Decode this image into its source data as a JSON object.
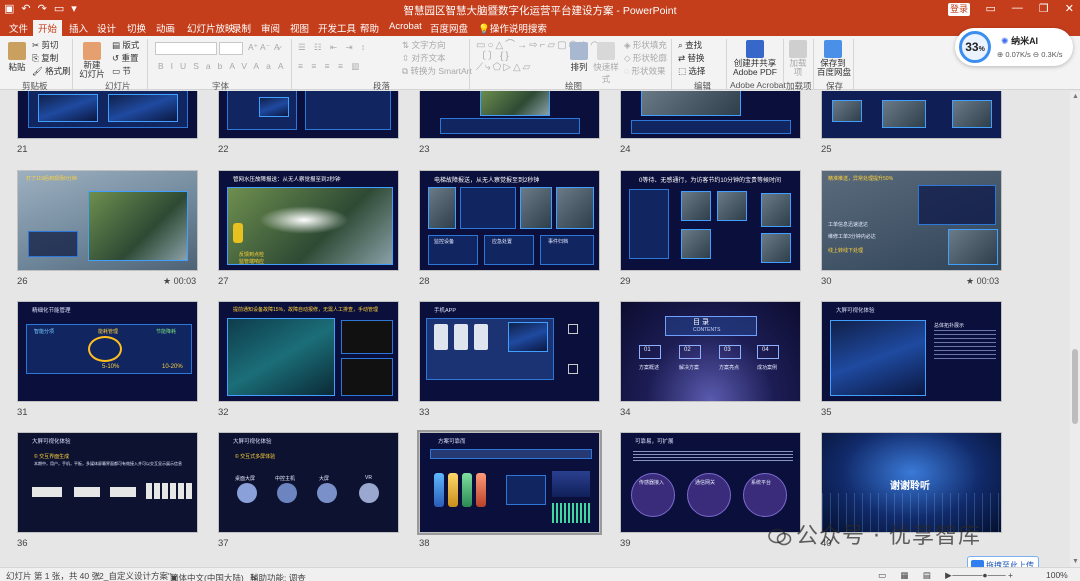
{
  "window": {
    "title": "智慧园区智慧大脑暨数字化运营平台建设方案 - PowerPoint",
    "login_label": "登录",
    "quick_access": [
      "save-icon",
      "undo-icon",
      "redo-icon",
      "open-icon"
    ]
  },
  "tabs": [
    "文件",
    "开始",
    "插入",
    "设计",
    "切换",
    "动画",
    "幻灯片放映",
    "录制",
    "审阅",
    "视图",
    "开发工具",
    "帮助",
    "Acrobat",
    "百度网盘",
    "操作说明搜索"
  ],
  "active_tab": "开始",
  "ribbon": {
    "clipboard": {
      "paste": "粘贴",
      "cut": "剪切",
      "copy": "复制",
      "format_painter": "格式刷",
      "group": "剪贴板"
    },
    "slides": {
      "new_slide": "新建\n幻灯片",
      "layout": "版式",
      "reset": "重置",
      "section": "节",
      "group": "幻灯片"
    },
    "font": {
      "group": "字体",
      "buttons": [
        "B",
        "I",
        "U",
        "S",
        "ab",
        "AV",
        "Aa",
        "A"
      ]
    },
    "paragraph": {
      "group": "段落",
      "text_direction": "文字方向",
      "align_text": "对齐文本",
      "smartart": "转换为 SmartArt"
    },
    "drawing": {
      "group": "绘图",
      "arrange": "排列",
      "quick_styles": "快速样式",
      "shape_fill": "形状填充",
      "shape_outline": "形状轮廓",
      "shape_effects": "形状效果"
    },
    "editing": {
      "group": "编辑",
      "find": "查找",
      "replace": "替换",
      "select": "选择"
    },
    "acrobat": {
      "group": "Adobe Acrobat",
      "create": "创建并共享\nAdobe PDF"
    },
    "addins": {
      "group": "加载项",
      "label": "加载\n项"
    },
    "save": {
      "group": "保存",
      "label": "保存到\n百度网盘"
    }
  },
  "ai_widget": {
    "percent": "33",
    "percent_sign": "%",
    "name": "纳米AI",
    "up": "0.07K/s",
    "down": "0.3K/s"
  },
  "slides": [
    {
      "num": "21"
    },
    {
      "num": "22"
    },
    {
      "num": "23"
    },
    {
      "num": "24"
    },
    {
      "num": "25"
    },
    {
      "num": "26",
      "time": "00:03",
      "title": "打了119后到现场0分钟"
    },
    {
      "num": "27",
      "title": "管网水压故障报送：从无人察觉报至到2秒钟",
      "t1": "反馈到点检",
      "t2": "监管端响应"
    },
    {
      "num": "28",
      "title": "电梯故障报送，从无人察觉报至到2秒钟",
      "b1": "监控设备",
      "b2": "应急处置",
      "b3": "事件归档"
    },
    {
      "num": "29",
      "title": "0等待、无感通行，为访客节约10分钟的宝贵等候时间"
    },
    {
      "num": "30",
      "time": "00:03",
      "title": "精准推送，异常处理提升50%",
      "t1": "工单信息迅速送达",
      "t2": "维修工单3分钟内必达",
      "t3": "线上转线下处理"
    },
    {
      "num": "31",
      "title": "精细化节能管理",
      "c1": "智能分项",
      "c2": "能耗管理",
      "c3": "节能降耗",
      "v1": "5-10%",
      "v2": "10-20%"
    },
    {
      "num": "32",
      "title": "提前通知设备故障15%，故障自动报修，无需人工排查，手动管理"
    },
    {
      "num": "33",
      "title": "手机APP"
    },
    {
      "num": "34",
      "toc_title": "目  录",
      "toc_sub": "CONTENTS",
      "toc_items": [
        "01",
        "02",
        "03",
        "04"
      ],
      "toc_labels": [
        "方案概述",
        "解决方案",
        "方案亮点",
        "成功案例"
      ]
    },
    {
      "num": "35",
      "title": "大屏可视化体验",
      "side": "总体拓扑展示"
    },
    {
      "num": "36",
      "title": "大屏可视化体验",
      "sub": "© 交互界面生成",
      "desc": "本期中，用户，手机，平板，多媒体屏幕界面都可有效接入并可以交互显示展示信息"
    },
    {
      "num": "37",
      "title": "大屏可视化体验",
      "sub": "© 交互式多屏体验",
      "icons": [
        "桌面大屏",
        "中控主机",
        "大屏",
        "VR"
      ]
    },
    {
      "num": "38",
      "title": "方案可靠而"
    },
    {
      "num": "39",
      "title": "可靠易，可扩展",
      "c1": "传感器接入",
      "c2": "通信网关",
      "c3": "系统平台"
    },
    {
      "num": "40",
      "text": "谢谢聆听"
    }
  ],
  "status": {
    "slide_info": "幻灯片 第 1 张，共 40 张",
    "theme": "\"2_自定义设计方案\"",
    "language": "简体中文(中国大陆)",
    "accessibility": "辅助功能: 调查",
    "zoom": "100%"
  },
  "watermark": "公众号 · 优享智库",
  "upload_label": "拖拽至此上传"
}
